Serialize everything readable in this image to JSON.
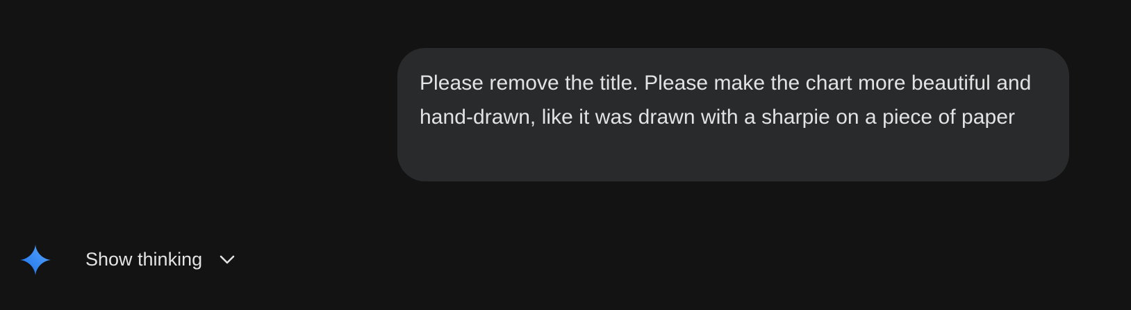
{
  "conversation": {
    "user_message": {
      "text": "Please remove the title. Please make the chart more beautiful and hand-drawn, like it was drawn with a sharpie on a piece of paper"
    },
    "assistant": {
      "avatar_icon": "gemini-sparkle-icon",
      "thinking_toggle_label": "Show thinking",
      "toggle_icon": "chevron-down-icon"
    }
  },
  "colors": {
    "background": "#131314",
    "bubble": "#282a2c",
    "text": "#e3e3e3",
    "sparkle_gradient_start": "#1c7cf5",
    "sparkle_gradient_end": "#4fa0ff"
  }
}
